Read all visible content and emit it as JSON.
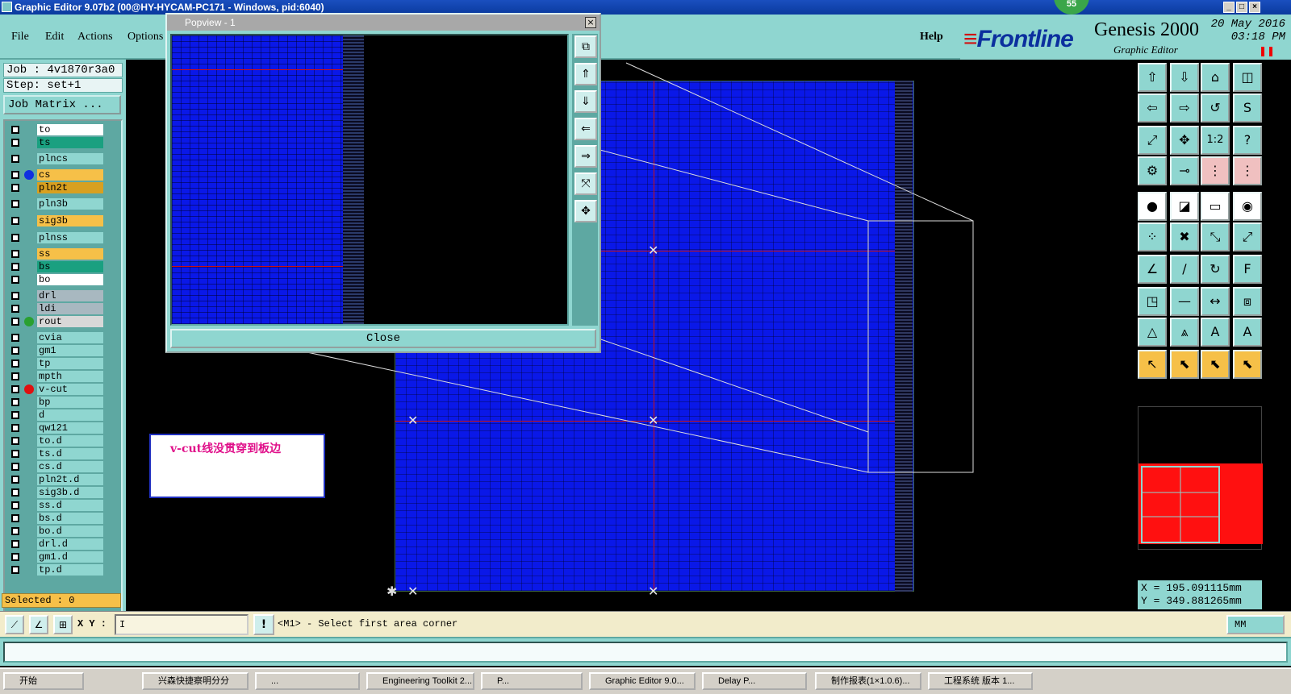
{
  "window": {
    "title": "Graphic Editor 9.07b2 (00@HY-HYCAM-PC171 - Windows, pid:6040)",
    "badge": "55"
  },
  "menu": {
    "file": "File",
    "edit": "Edit",
    "actions": "Actions",
    "options": "Options",
    "help": "Help"
  },
  "brand": {
    "frontline": "Frontline",
    "genesis": "Genesis 2000",
    "subtitle": "Graphic Editor",
    "date_line1": "20 May 2016",
    "date_line2": "03:18 PM"
  },
  "job": {
    "job_label": "Job : 4v1870r3a0",
    "step_label": "Step: set+1",
    "matrix_button": "Job Matrix ..."
  },
  "layers": [
    {
      "name": "to",
      "color": "#ffffff",
      "dot": ""
    },
    {
      "name": "ts",
      "color": "#1aa080",
      "dot": ""
    },
    {
      "name": "plncs",
      "color": "#8fd6d0",
      "dot": ""
    },
    {
      "name": "cs",
      "color": "#f6c048",
      "dot": "#1030e0"
    },
    {
      "name": "pln2t",
      "color": "#d8a020",
      "dot": ""
    },
    {
      "name": "pln3b",
      "color": "#8fd6d0",
      "dot": ""
    },
    {
      "name": "sig3b",
      "color": "#f6c048",
      "dot": ""
    },
    {
      "name": "plnss",
      "color": "#8fd6d0",
      "dot": ""
    },
    {
      "name": "ss",
      "color": "#f6c048",
      "dot": ""
    },
    {
      "name": "bs",
      "color": "#1aa080",
      "dot": ""
    },
    {
      "name": "bo",
      "color": "#ffffff",
      "dot": ""
    },
    {
      "name": "drl",
      "color": "#a8b8c0",
      "dot": ""
    },
    {
      "name": "ldi",
      "color": "#a8b8c0",
      "dot": ""
    },
    {
      "name": "rout",
      "color": "#d8d8d8",
      "dot": "#2aa030"
    },
    {
      "name": "cvia",
      "color": "#8fd6d0",
      "dot": ""
    },
    {
      "name": "gm1",
      "color": "#8fd6d0",
      "dot": ""
    },
    {
      "name": "tp",
      "color": "#8fd6d0",
      "dot": ""
    },
    {
      "name": "mpth",
      "color": "#8fd6d0",
      "dot": ""
    },
    {
      "name": "v-cut",
      "color": "#8fd6d0",
      "dot": "#e01010"
    },
    {
      "name": "bp",
      "color": "#8fd6d0",
      "dot": ""
    },
    {
      "name": "d",
      "color": "#8fd6d0",
      "dot": ""
    },
    {
      "name": "qw121",
      "color": "#8fd6d0",
      "dot": ""
    },
    {
      "name": "to.d",
      "color": "#8fd6d0",
      "dot": ""
    },
    {
      "name": "ts.d",
      "color": "#8fd6d0",
      "dot": ""
    },
    {
      "name": "cs.d",
      "color": "#8fd6d0",
      "dot": ""
    },
    {
      "name": "pln2t.d",
      "color": "#8fd6d0",
      "dot": ""
    },
    {
      "name": "sig3b.d",
      "color": "#8fd6d0",
      "dot": ""
    },
    {
      "name": "ss.d",
      "color": "#8fd6d0",
      "dot": ""
    },
    {
      "name": "bs.d",
      "color": "#8fd6d0",
      "dot": ""
    },
    {
      "name": "bo.d",
      "color": "#8fd6d0",
      "dot": ""
    },
    {
      "name": "drl.d",
      "color": "#8fd6d0",
      "dot": ""
    },
    {
      "name": "gm1.d",
      "color": "#8fd6d0",
      "dot": ""
    },
    {
      "name": "tp.d",
      "color": "#8fd6d0",
      "dot": ""
    }
  ],
  "selected": "Selected : 0",
  "note": "v-cut线没贯穿到板边",
  "popview": {
    "title": "Popview - 1",
    "close_button": "Close"
  },
  "coords": {
    "x": "X =  195.091115mm",
    "y": "Y =  349.881265mm"
  },
  "status": {
    "xy_label": "X Y :",
    "xy_value": "I",
    "message": "<M1> - Select first area corner",
    "unit": "MM"
  },
  "taskbar": {
    "items": [
      "开始",
      "兴森快捷察明分分",
      "...",
      "Engineering Toolkit 2...",
      "P...",
      "Graphic Editor 9.0...",
      "Delay P...",
      "制作报表(1×1.0.6)...",
      "工程系统 版本 1..."
    ]
  }
}
